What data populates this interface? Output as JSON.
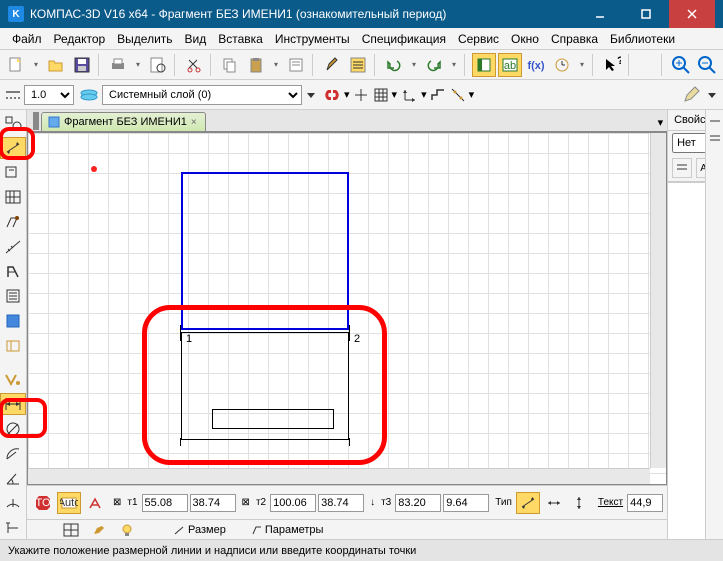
{
  "app": {
    "title": "КОМПАС-3D V16  x64 - Фрагмент БЕЗ ИМЕНИ1 (ознакомительный период)",
    "icon_letter": "K"
  },
  "menu": [
    "Файл",
    "Редактор",
    "Выделить",
    "Вид",
    "Вставка",
    "Инструменты",
    "Спецификация",
    "Сервис",
    "Окно",
    "Справка",
    "Библиотеки"
  ],
  "tb2": {
    "thickness": "1.0",
    "layer": "Системный слой (0)"
  },
  "doctab": {
    "label": "Фрагмент БЕЗ ИМЕНИ1"
  },
  "canvas": {
    "lbl1": "1",
    "lbl2": "2"
  },
  "bt": {
    "t1_label": "т1",
    "t1x": "55.08",
    "t1y": "38.74",
    "t2_label": "т2",
    "t2x": "100.06",
    "t2y": "38.74",
    "t3_label": "т3",
    "t3x": "83.20",
    "t3y": "9.64",
    "tip_label": "Тип",
    "text_label": "Текст",
    "text_val": "44,9",
    "tab1": "Размер",
    "tab2": "Параметры"
  },
  "props": {
    "title": "Свойства",
    "dropdown": "Нет"
  },
  "status": "Укажите положение размерной линии и надписи или введите координаты точки"
}
